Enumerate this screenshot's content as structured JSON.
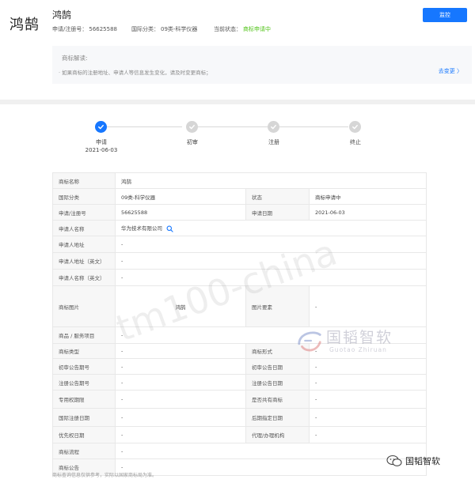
{
  "header": {
    "logo_text": "鸿鹄",
    "title": "鸿鹄",
    "reg_no_label": "申请/注册号：",
    "reg_no": "56625588",
    "class_label": "国际分类：",
    "class_value": "09类-科学仪器",
    "status_label": "当前状态：",
    "status_value": "商标申请中",
    "monitor_button": "监控"
  },
  "interpret": {
    "title": "商标解读:",
    "text": "· 如果商标的注册地址、申请人等信息发生变化，请及时变更商标；",
    "link": "去变更 〉"
  },
  "steps": [
    {
      "label": "申请",
      "date": "2021-06-03",
      "active": true
    },
    {
      "label": "初审",
      "date": "",
      "active": false
    },
    {
      "label": "注册",
      "date": "",
      "active": false
    },
    {
      "label": "终止",
      "date": "",
      "active": false
    }
  ],
  "table": {
    "mark_name_label": "商标名称",
    "mark_name": "鸿鹄",
    "class_label": "国际分类",
    "class_value": "09类-科学仪器",
    "status_label": "状态",
    "status_value": "商标申请中",
    "reg_no_label": "申请/注册号",
    "reg_no": "56625588",
    "apply_date_label": "申请日期",
    "apply_date": "2021-06-03",
    "applicant_label": "申请人名称",
    "applicant": "华为技术有限公司",
    "applicant_addr_label": "申请人地址",
    "applicant_addr": "-",
    "applicant_addr_en_label": "申请人地址（英文）",
    "applicant_addr_en": "-",
    "applicant_name_en_label": "申请人名称（英文）",
    "applicant_name_en": "-",
    "mark_image_label": "商标图片",
    "mark_image_text": "鸿鹄",
    "image_elements_label": "图片要素",
    "image_elements": "-",
    "goods_label": "商品 / 服务项目",
    "goods": "-",
    "mark_type_label": "商标类型",
    "mark_type": "-",
    "mark_form_label": "商标形式",
    "mark_form": "-",
    "prelim_no_label": "初审公告期号",
    "prelim_no": "-",
    "prelim_date_label": "初审公告日期",
    "prelim_date": "-",
    "reg_pub_no_label": "注册公告期号",
    "reg_pub_no": "-",
    "reg_pub_date_label": "注册公告日期",
    "reg_pub_date": "-",
    "exclusive_label": "专用权期限",
    "exclusive": "-",
    "shared_label": "是否共有商标",
    "shared": "-",
    "intl_reg_date_label": "国际注册日期",
    "intl_reg_date": "-",
    "later_date_label": "后期指定日期",
    "later_date": "-",
    "priority_label": "优先权日期",
    "priority": "-",
    "agent_label": "代理/办理机构",
    "agent": "-",
    "process_label": "商标流程",
    "process": "-",
    "notice_label": "商标公告",
    "notice": "-"
  },
  "watermarks": {
    "diag": "tm100-china",
    "brand": "国韬智软",
    "brand_sub": "Guotao Zhiruan"
  },
  "footer_note": "商标查询信息仅供参考，实际以国家商标局为准。",
  "brand_badge": "国韬智软",
  "colors": {
    "primary": "#1677ff",
    "status_green": "#52c41a"
  }
}
